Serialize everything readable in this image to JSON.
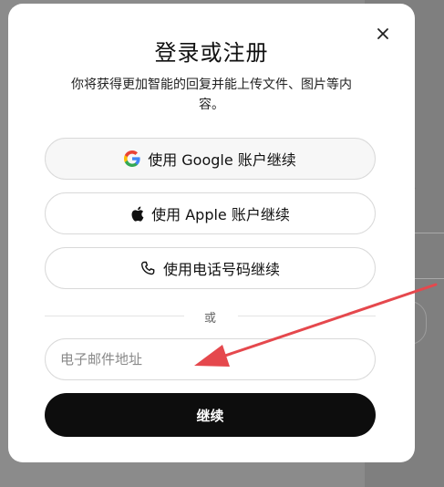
{
  "dialog": {
    "title": "登录或注册",
    "subtitle": "你将获得更加智能的回复并能上传文件、图片等内容。"
  },
  "buttons": {
    "google": {
      "label": "使用 Google 账户继续",
      "icon": "google-g-icon"
    },
    "apple": {
      "label": "使用 Apple 账户继续",
      "icon": "apple-icon"
    },
    "phone": {
      "label": "使用电话号码继续",
      "icon": "phone-icon"
    }
  },
  "divider": {
    "label": "或"
  },
  "email": {
    "placeholder": "电子邮件地址",
    "value": ""
  },
  "continue": {
    "label": "继续"
  },
  "background": {
    "partial_text": "?"
  },
  "colors": {
    "primary_button": "#0d0d0d",
    "annotation_arrow": "#e5484d",
    "overlay": "#8b8b8b"
  }
}
